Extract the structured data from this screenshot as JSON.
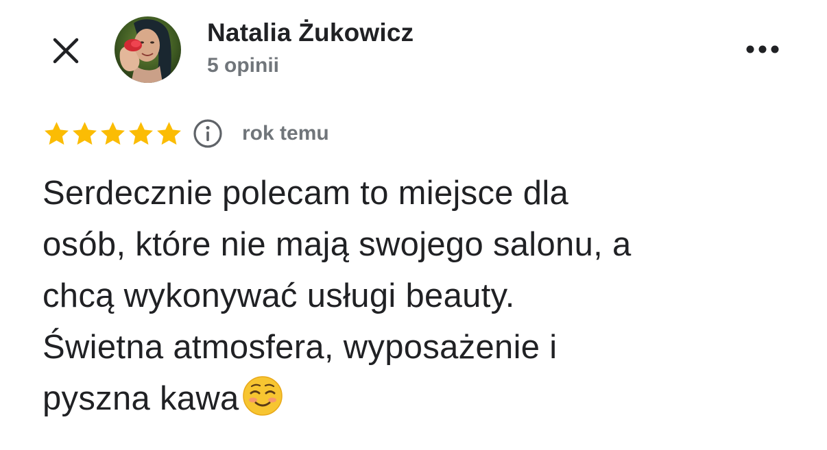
{
  "header": {
    "close_icon": "close-icon",
    "author_name": "Natalia Żukowicz",
    "author_reviews": "5 opinii",
    "more_icon": "more-horizontal-icon"
  },
  "review": {
    "rating": 5,
    "rating_max": 5,
    "info_icon": "info-icon",
    "date": "rok temu",
    "text": "Serdecznie polecam to miejsce dla\nosób, które nie mają swojego salonu, a\nchcą wykonywać usługi beauty.\nŚwietna atmosfera, wyposażenie i\npyszna kawa",
    "emoji": "smiling-face-icon"
  },
  "colors": {
    "star": "#fbbc04",
    "text": "#202124",
    "secondary_text": "#70757a"
  }
}
